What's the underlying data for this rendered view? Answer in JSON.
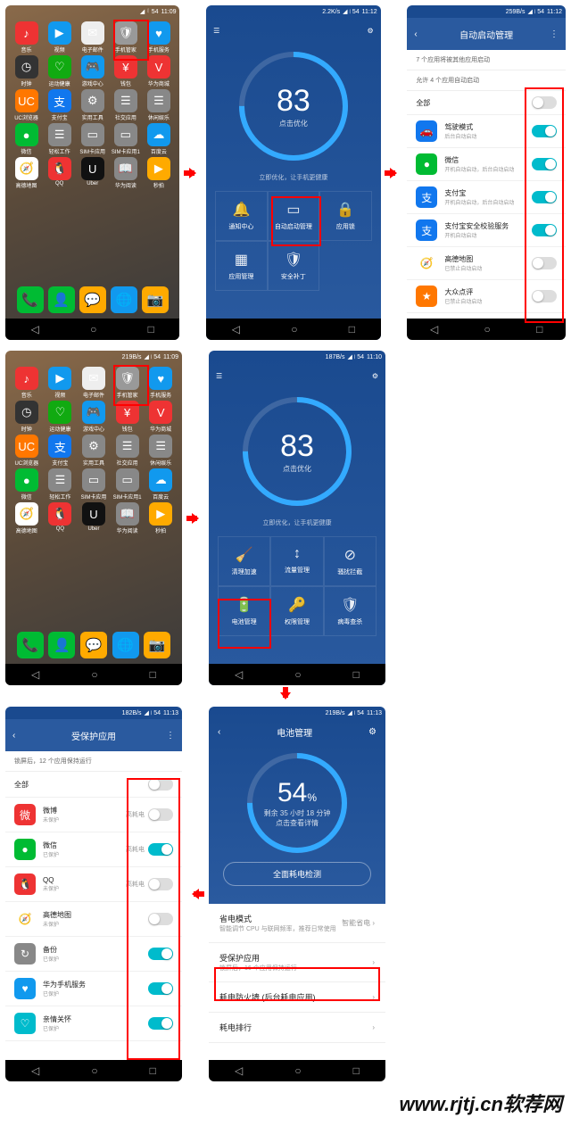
{
  "status": {
    "t1": "11:09",
    "t2": "11:12",
    "t3": "11:12",
    "t4": "11:09",
    "t5": "11:10",
    "t6": "11:13",
    "t7": "11:13",
    "sp1": "2.2K/s",
    "sp2": "259B/s",
    "sp3": "219B/s",
    "sp4": "187B/s",
    "sp5": "182B/s",
    "sp6": "219B/s",
    "bat": "54"
  },
  "home": {
    "apps": [
      {
        "l": "音乐",
        "c": "#e33",
        "g": "♪"
      },
      {
        "l": "视频",
        "c": "#19e",
        "g": "▶"
      },
      {
        "l": "电子邮件",
        "c": "#eee",
        "g": "✉"
      },
      {
        "l": "手机管家",
        "c": "#999",
        "g": "🛡"
      },
      {
        "l": "手机服务",
        "c": "#19e",
        "g": "♥"
      },
      {
        "l": "时钟",
        "c": "#333",
        "g": "◷"
      },
      {
        "l": "运动健康",
        "c": "#1a1",
        "g": "♡"
      },
      {
        "l": "游戏中心",
        "c": "#19e",
        "g": "🎮"
      },
      {
        "l": "钱包",
        "c": "#e33",
        "g": "¥"
      },
      {
        "l": "华为商城",
        "c": "#e33",
        "g": "V"
      },
      {
        "l": "UC浏览器",
        "c": "#f70",
        "g": "UC"
      },
      {
        "l": "支付宝",
        "c": "#17e",
        "g": "支"
      },
      {
        "l": "实用工具",
        "c": "#888",
        "g": "⚙"
      },
      {
        "l": "社交应用",
        "c": "#888",
        "g": "☰"
      },
      {
        "l": "休闲娱乐",
        "c": "#888",
        "g": "☰"
      },
      {
        "l": "微信",
        "c": "#0b3",
        "g": "●"
      },
      {
        "l": "轻松工作",
        "c": "#888",
        "g": "☰"
      },
      {
        "l": "SIM卡应用",
        "c": "#888",
        "g": "▭"
      },
      {
        "l": "SIM卡应用1",
        "c": "#888",
        "g": "▭"
      },
      {
        "l": "百度云",
        "c": "#19e",
        "g": "☁"
      },
      {
        "l": "高德地图",
        "c": "#fff",
        "g": "🧭"
      },
      {
        "l": "QQ",
        "c": "#e33",
        "g": "🐧"
      },
      {
        "l": "Uber",
        "c": "#111",
        "g": "U"
      },
      {
        "l": "华为阅读",
        "c": "#888",
        "g": "📖"
      },
      {
        "l": "秒拍",
        "c": "#fa0",
        "g": "▶"
      }
    ],
    "dock": [
      {
        "c": "#0b3",
        "g": "📞"
      },
      {
        "c": "#0b3",
        "g": "👤"
      },
      {
        "c": "#fa0",
        "g": "💬"
      },
      {
        "c": "#19e",
        "g": "🌐"
      },
      {
        "c": "#fa0",
        "g": "📷"
      }
    ]
  },
  "mgr1": {
    "score": "83",
    "scorelbl": "点击优化",
    "tip": "立即优化，让手机更健康",
    "items": [
      {
        "l": "通知中心",
        "g": "🔔"
      },
      {
        "l": "自动启动管理",
        "g": "▭"
      },
      {
        "l": "应用锁",
        "g": "🔒"
      },
      {
        "l": "应用管理",
        "g": "▦"
      },
      {
        "l": "安全补丁",
        "g": "🛡"
      }
    ]
  },
  "mgr2": {
    "score": "83",
    "scorelbl": "点击优化",
    "tip": "立即优化，让手机更健康",
    "items": [
      {
        "l": "清理加速",
        "g": "🧹"
      },
      {
        "l": "流量管理",
        "g": "↕"
      },
      {
        "l": "骚扰拦截",
        "g": "⊘"
      },
      {
        "l": "电池管理",
        "g": "🔋"
      },
      {
        "l": "权限管理",
        "g": "🔑"
      },
      {
        "l": "病毒查杀",
        "g": "🛡"
      }
    ]
  },
  "auto": {
    "title": "自动启动管理",
    "info1": "7 个应用将被其他应用启动",
    "info2": "允许 4 个应用自动启动",
    "all": "全部",
    "items": [
      {
        "n": "驾驶模式",
        "s": "后台自动启动",
        "c": "#17e",
        "g": "🚗",
        "on": true
      },
      {
        "n": "微信",
        "s": "开机自动启动，后台自动启动",
        "c": "#0b3",
        "g": "●",
        "on": true
      },
      {
        "n": "支付宝",
        "s": "开机自动启动，后台自动启动",
        "c": "#17e",
        "g": "支",
        "on": true
      },
      {
        "n": "支付宝安全校验服务",
        "s": "开机自动启动",
        "c": "#17e",
        "g": "支",
        "on": true
      },
      {
        "n": "高德地图",
        "s": "已禁止自动启动",
        "c": "#fff",
        "g": "🧭",
        "on": false
      },
      {
        "n": "大众点评",
        "s": "已禁止自动启动",
        "c": "#f70",
        "g": "★",
        "on": false
      }
    ]
  },
  "bat": {
    "title": "电池管理",
    "pct": "54",
    "rem": "剩余 35 小时 18 分钟",
    "hint": "点击查看详情",
    "detect": "全面耗电检测",
    "note": "锁屏后，16 个应用保持运行",
    "items": [
      {
        "t": "省电模式",
        "s": "智能调节 CPU 与联网频率，推荐日常使用",
        "r": "智能省电 ›"
      },
      {
        "t": "受保护应用",
        "s": "锁屏后，16 个应用保持运行",
        "r": "›"
      },
      {
        "t": "耗电防火墙 (后台耗电应用)",
        "s": "",
        "r": "›"
      },
      {
        "t": "耗电排行",
        "s": "",
        "r": "›"
      }
    ]
  },
  "prot": {
    "title": "受保护应用",
    "info": "锁屏后，12 个应用保持运行",
    "all": "全部",
    "hi": "高耗电",
    "items": [
      {
        "n": "微博",
        "s": "未保护",
        "c": "#e33",
        "g": "微",
        "on": false,
        "hi": true
      },
      {
        "n": "微信",
        "s": "已保护",
        "c": "#0b3",
        "g": "●",
        "on": true,
        "hi": true
      },
      {
        "n": "QQ",
        "s": "未保护",
        "c": "#e33",
        "g": "🐧",
        "on": false,
        "hi": true
      },
      {
        "n": "高德地图",
        "s": "未保护",
        "c": "#fff",
        "g": "🧭",
        "on": false,
        "hi": false
      },
      {
        "n": "备份",
        "s": "已保护",
        "c": "#888",
        "g": "↻",
        "on": true,
        "hi": false
      },
      {
        "n": "华为手机服务",
        "s": "已保护",
        "c": "#19e",
        "g": "♥",
        "on": true,
        "hi": false
      },
      {
        "n": "亲情关怀",
        "s": "已保护",
        "c": "#0bc",
        "g": "♡",
        "on": true,
        "hi": false
      }
    ]
  },
  "watermark": "www.rjtj.cn软荐网"
}
